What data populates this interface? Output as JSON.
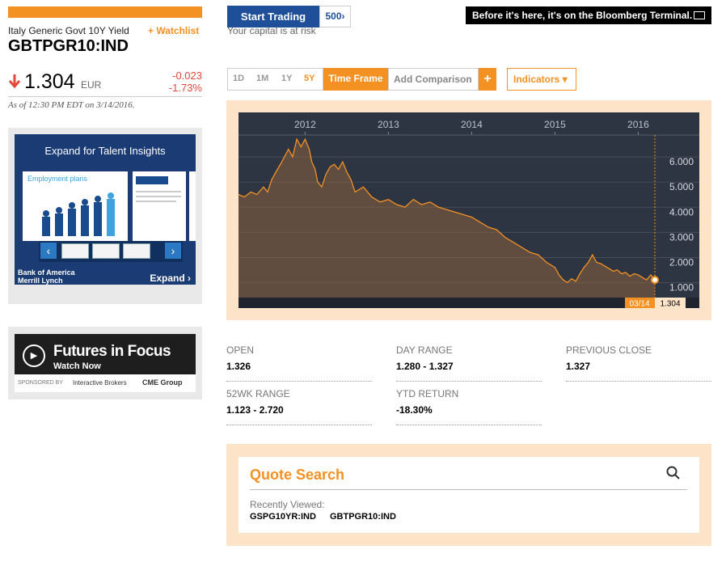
{
  "header": {
    "security_name": "Italy Generic Govt 10Y Yield",
    "watchlist_label": "+ Watchlist",
    "ticker": "GBTPGR10:IND",
    "price": "1.304",
    "currency": "EUR",
    "change_abs": "-0.023",
    "change_pct": "-1.73%",
    "as_of": "As of 12:30 PM EDT on 3/14/2016.",
    "direction_icon": "arrow-down-icon",
    "down_color": "#e2483c"
  },
  "top_banner": {
    "trade_button": "Start Trading",
    "trade_logo": "500›",
    "capital_risk": "Your capital is at risk",
    "terminal_text": "Before it's here, it's on the Bloomberg Terminal."
  },
  "ads": {
    "talent": {
      "title": "Expand for Talent Insights",
      "card_title": "Employment plans",
      "bank": "Bank of America\nMerrill Lynch",
      "expand": "Expand ›"
    },
    "futures": {
      "title": "Futures in Focus",
      "watch": "Watch Now",
      "sponsored": "SPONSORED BY",
      "broker": "Interactive Brokers",
      "cme": "CME Group"
    }
  },
  "controls": {
    "ranges": [
      "1D",
      "1M",
      "1Y",
      "5Y"
    ],
    "active_range": "5Y",
    "timeframe": "Time Frame",
    "add_comparison": "Add Comparison",
    "add_plus": "+",
    "indicators": "Indicators ▾",
    "accent_color": "#f39123"
  },
  "chart_data": {
    "type": "area",
    "x_tick_labels": [
      "2012",
      "2013",
      "2014",
      "2015",
      "2016"
    ],
    "y_tick_labels": [
      "6.000",
      "5.000",
      "4.000",
      "3.000",
      "2.000",
      "1.000"
    ],
    "ylim": [
      0.6,
      7.0
    ],
    "line_color": "#f39123",
    "last_point_label": "03/14",
    "last_value_label": "1.304",
    "x": [
      2011.2,
      2011.27,
      2011.35,
      2011.42,
      2011.5,
      2011.55,
      2011.6,
      2011.65,
      2011.72,
      2011.8,
      2011.85,
      2011.9,
      2011.95,
      2012.0,
      2012.05,
      2012.08,
      2012.12,
      2012.15,
      2012.2,
      2012.25,
      2012.3,
      2012.35,
      2012.4,
      2012.45,
      2012.5,
      2012.55,
      2012.6,
      2012.7,
      2012.8,
      2012.9,
      2013.0,
      2013.1,
      2013.2,
      2013.3,
      2013.4,
      2013.5,
      2013.6,
      2013.7,
      2013.8,
      2013.9,
      2014.0,
      2014.1,
      2014.2,
      2014.3,
      2014.4,
      2014.5,
      2014.6,
      2014.7,
      2014.8,
      2014.9,
      2015.0,
      2015.05,
      2015.1,
      2015.15,
      2015.2,
      2015.25,
      2015.3,
      2015.35,
      2015.4,
      2015.45,
      2015.5,
      2015.55,
      2015.6,
      2015.65,
      2015.7,
      2015.75,
      2015.8,
      2015.85,
      2015.9,
      2015.95,
      2016.0,
      2016.05,
      2016.1,
      2016.15,
      2016.2
    ],
    "values": [
      4.7,
      4.6,
      4.8,
      4.7,
      5.0,
      4.8,
      5.3,
      5.6,
      6.0,
      6.5,
      6.2,
      6.9,
      6.6,
      6.9,
      6.5,
      6.0,
      5.7,
      5.2,
      5.0,
      5.5,
      5.8,
      5.9,
      5.7,
      6.0,
      5.6,
      5.3,
      4.8,
      5.0,
      4.6,
      4.4,
      4.5,
      4.3,
      4.2,
      4.5,
      4.3,
      4.4,
      4.2,
      4.1,
      4.0,
      3.9,
      3.8,
      3.6,
      3.4,
      3.3,
      3.0,
      2.8,
      2.6,
      2.4,
      2.3,
      2.0,
      1.8,
      1.5,
      1.3,
      1.2,
      1.35,
      1.25,
      1.55,
      1.8,
      2.0,
      2.3,
      2.0,
      1.95,
      1.85,
      1.75,
      1.65,
      1.7,
      1.55,
      1.6,
      1.45,
      1.55,
      1.5,
      1.4,
      1.3,
      1.5,
      1.304
    ]
  },
  "stats": [
    {
      "label": "OPEN",
      "value": "1.326"
    },
    {
      "label": "DAY RANGE",
      "value": "1.280 - 1.327"
    },
    {
      "label": "PREVIOUS CLOSE",
      "value": "1.327"
    },
    {
      "label": "52WK RANGE",
      "value": "1.123 - 2.720"
    },
    {
      "label": "YTD RETURN",
      "value": "-18.30%"
    }
  ],
  "quote_search": {
    "title": "Quote Search",
    "recently_viewed": "Recently Viewed:",
    "items": [
      "GSPG10YR:IND",
      "GBTPGR10:IND"
    ]
  }
}
